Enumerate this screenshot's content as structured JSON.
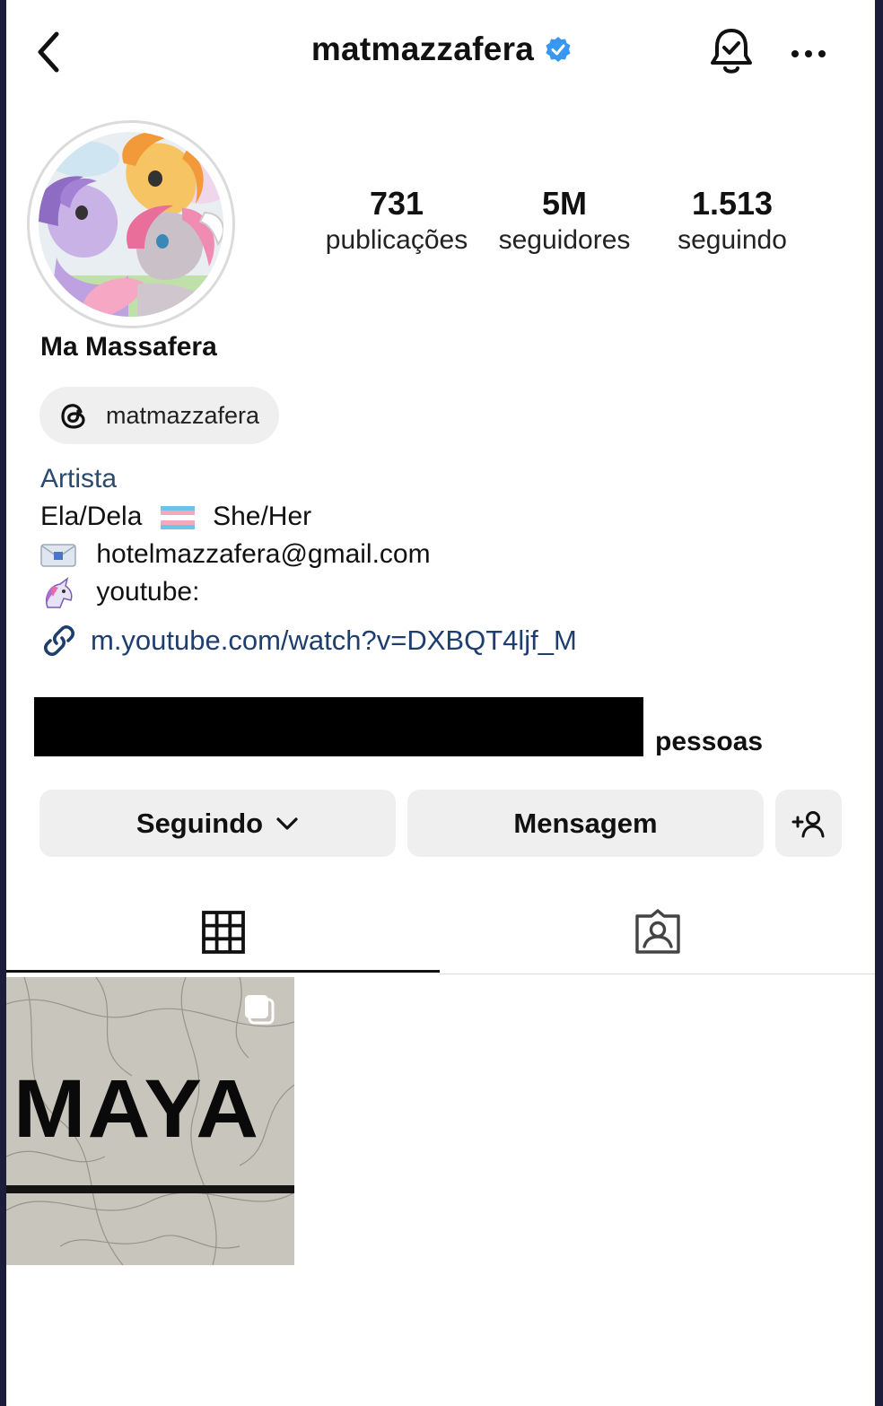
{
  "header": {
    "username": "matmazzafera",
    "verified": true,
    "icons": {
      "back": "chevron-left-icon",
      "bell": "bell-check-icon",
      "more": "more-horizontal-icon",
      "verified": "verified-badge-icon"
    }
  },
  "profile": {
    "display_name": "Ma Massafera",
    "avatar_label": "profile avatar - pony illustration",
    "stats": [
      {
        "value": "731",
        "label": "publicações"
      },
      {
        "value": "5M",
        "label": "seguidores"
      },
      {
        "value": "1.513",
        "label": "seguindo"
      }
    ],
    "threads_handle": "matmazzafera",
    "category": "Artista",
    "bio_lines": {
      "pronouns_left": "Ela/Dela",
      "pronouns_right": "She/Her",
      "email": "hotelmazzafera@gmail.com",
      "youtube": "youtube:"
    },
    "link": "m.youtube.com/watch?v=DXBQT4ljf_M",
    "followed_by_tail": "pessoas"
  },
  "actions": {
    "following_label": "Seguindo",
    "message_label": "Mensagem"
  },
  "tabs": [
    {
      "name": "posts-grid",
      "icon": "grid-icon",
      "active": true
    },
    {
      "name": "tagged",
      "icon": "tagged-person-icon",
      "active": false
    }
  ],
  "posts": [
    {
      "text": "MAYA",
      "type": "carousel"
    }
  ],
  "colors": {
    "verified": "#3897f0",
    "link": "#1e3e6e",
    "button_bg": "#efefef",
    "frame": "#1c1d3a"
  }
}
